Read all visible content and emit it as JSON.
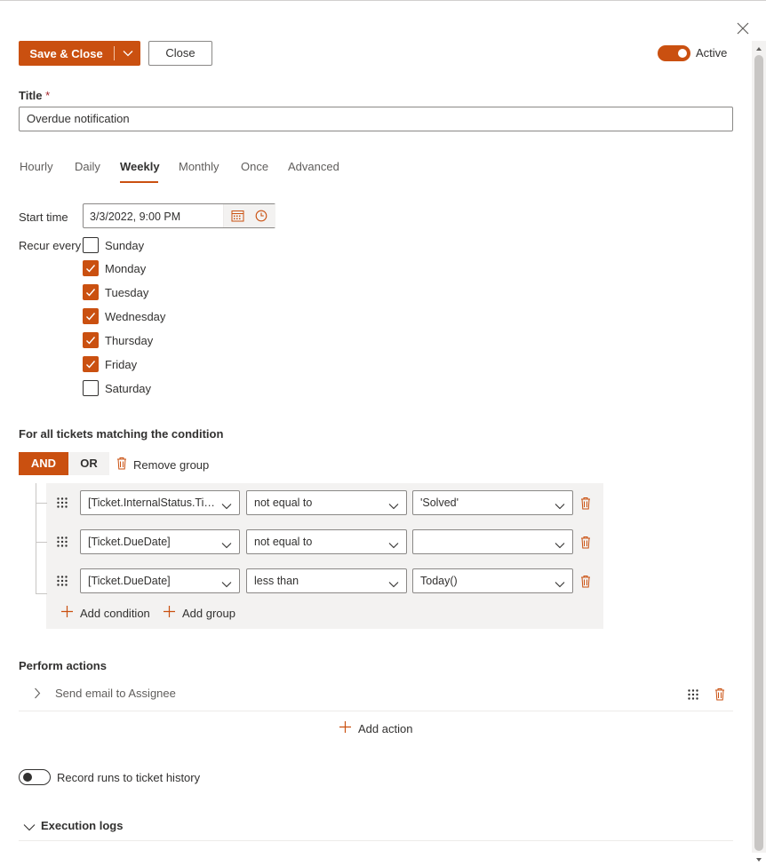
{
  "header": {
    "save_label": "Save & Close",
    "close_label": "Close",
    "active_label": "Active",
    "active_on": true
  },
  "title_field": {
    "label": "Title",
    "required_mark": "*",
    "value": "Overdue notification"
  },
  "tabs": [
    {
      "label": "Hourly",
      "selected": false
    },
    {
      "label": "Daily",
      "selected": false
    },
    {
      "label": "Weekly",
      "selected": true
    },
    {
      "label": "Monthly",
      "selected": false
    },
    {
      "label": "Once",
      "selected": false
    },
    {
      "label": "Advanced",
      "selected": false
    }
  ],
  "schedule": {
    "start_time_label": "Start time",
    "start_time_value": "3/3/2022, 9:00 PM",
    "recur_label": "Recur every",
    "days": [
      {
        "label": "Sunday",
        "checked": false
      },
      {
        "label": "Monday",
        "checked": true
      },
      {
        "label": "Tuesday",
        "checked": true
      },
      {
        "label": "Wednesday",
        "checked": true
      },
      {
        "label": "Thursday",
        "checked": true
      },
      {
        "label": "Friday",
        "checked": true
      },
      {
        "label": "Saturday",
        "checked": false
      }
    ]
  },
  "conditions": {
    "title": "For all tickets matching the condition",
    "and_label": "AND",
    "or_label": "OR",
    "remove_group_label": "Remove group",
    "rows": [
      {
        "field": "[Ticket.InternalStatus.Tit...",
        "operator": "not equal to",
        "value": "'Solved'"
      },
      {
        "field": "[Ticket.DueDate]",
        "operator": "not equal to",
        "value": ""
      },
      {
        "field": "[Ticket.DueDate]",
        "operator": "less than",
        "value": "Today()"
      }
    ],
    "add_condition_label": "Add condition",
    "add_group_label": "Add group"
  },
  "actions": {
    "title": "Perform actions",
    "items": [
      {
        "label": "Send email to Assignee"
      }
    ],
    "add_action_label": "Add action"
  },
  "record_runs": {
    "label": "Record runs to ticket history",
    "on": false
  },
  "execution_logs": {
    "label": "Execution logs"
  },
  "colors": {
    "accent": "#ca5010",
    "neutral_bg": "#f3f2f1",
    "text": "#323130"
  }
}
